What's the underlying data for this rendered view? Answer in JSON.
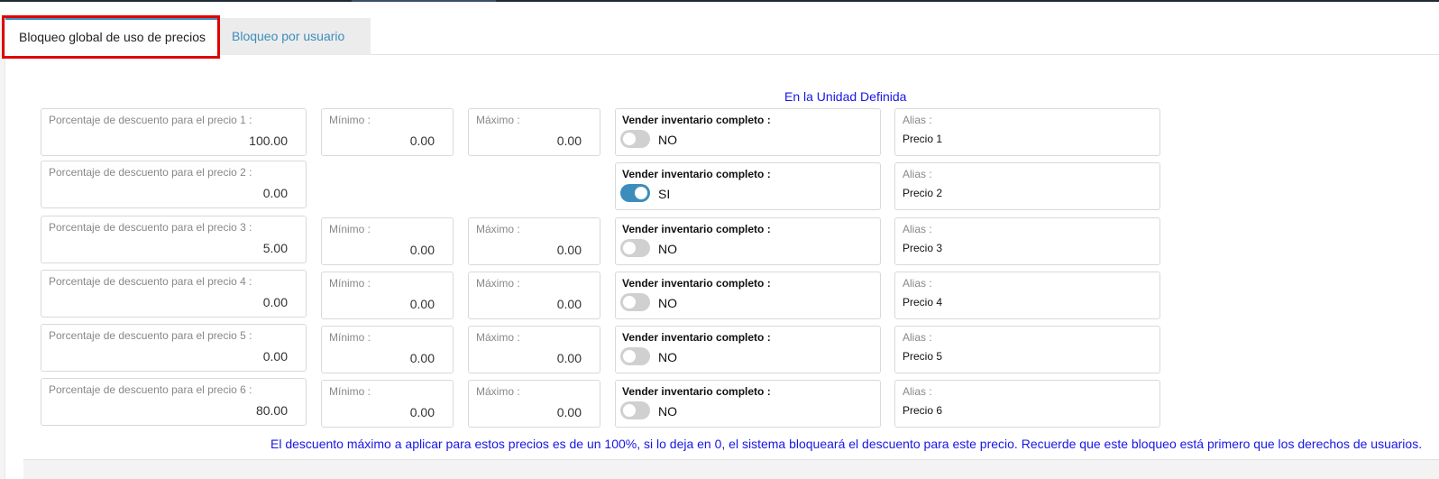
{
  "tabs": [
    {
      "label": "Bloqueo global de uso de precios",
      "active": true
    },
    {
      "label": "Bloqueo por usuario",
      "active": false
    }
  ],
  "unit_title": "En la Unidad Definida",
  "labels": {
    "minimo": "Mínimo :",
    "maximo": "Máximo :",
    "vender": "Vender inventario completo :",
    "alias": "Alias :"
  },
  "rows": [
    {
      "pct_label": "Porcentaje de descuento para el precio 1 :",
      "pct_value": "100.00",
      "min": "0.00",
      "max": "0.00",
      "vender": "NO",
      "vender_on": false,
      "alias": "Precio 1"
    },
    {
      "pct_label": "Porcentaje de descuento para el precio 2 :",
      "pct_value": "0.00",
      "vender": "SI",
      "vender_on": true,
      "alias": "Precio 2"
    },
    {
      "pct_label": "Porcentaje de descuento para el precio 3 :",
      "pct_value": "5.00",
      "min": "0.00",
      "max": "0.00",
      "vender": "NO",
      "vender_on": false,
      "alias": "Precio 3"
    },
    {
      "pct_label": "Porcentaje de descuento para el precio 4 :",
      "pct_value": "0.00",
      "min": "0.00",
      "max": "0.00",
      "vender": "NO",
      "vender_on": false,
      "alias": "Precio 4"
    },
    {
      "pct_label": "Porcentaje de descuento para el precio 5 :",
      "pct_value": "0.00",
      "min": "0.00",
      "max": "0.00",
      "vender": "NO",
      "vender_on": false,
      "alias": "Precio 5"
    },
    {
      "pct_label": "Porcentaje de descuento para el precio 6 :",
      "pct_value": "80.00",
      "min": "0.00",
      "max": "0.00",
      "vender": "NO",
      "vender_on": false,
      "alias": "Precio 6"
    }
  ],
  "footnote": "El descuento máximo a aplicar para estos precios es de un 100%, si lo deja en 0, el sistema bloqueará el descuento para este precio. Recuerde que este bloqueo está primero que los derechos de usuarios.",
  "colors": {
    "accent": "#3c8dbc",
    "highlight": "#e00000",
    "note_text": "#1717e6"
  }
}
